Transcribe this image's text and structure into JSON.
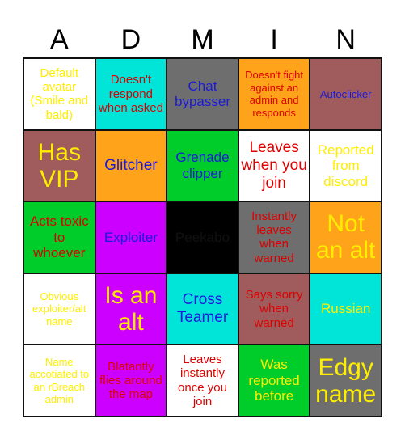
{
  "title_letters": [
    "A",
    "D",
    "M",
    "I",
    "N"
  ],
  "colors": {
    "white": "#ffffff",
    "cyan": "#00e5d8",
    "gray": "#6e6e6e",
    "orange": "#ffa31a",
    "mauve": "#a05c5c",
    "green": "#00cc2a",
    "purple": "#cc00ff",
    "black": "#000000",
    "text_yellow": "#ffee00",
    "text_red": "#dd0000",
    "text_blue": "#1a1adb",
    "text_black": "#111111",
    "grid_line": "#111111"
  },
  "cells": [
    {
      "text": "Default avatar (Smile and bald)",
      "bg": "#ffffff",
      "fg": "#ffee00",
      "size": "fs-s"
    },
    {
      "text": "Doesn't respond when asked",
      "bg": "#00e5d8",
      "fg": "#dd0000",
      "size": "fs-s"
    },
    {
      "text": "Chat bypasser",
      "bg": "#6e6e6e",
      "fg": "#1a1adb",
      "size": "fs-m"
    },
    {
      "text": "Doesn't fight against an admin and responds",
      "bg": "#ffa31a",
      "fg": "#dd0000",
      "size": "fs-xs"
    },
    {
      "text": "Autoclicker",
      "bg": "#a05c5c",
      "fg": "#1a1adb",
      "size": "fs-xs"
    },
    {
      "text": "Has VIP",
      "bg": "#a05c5c",
      "fg": "#ffee00",
      "size": "fs-xl"
    },
    {
      "text": "Glitcher",
      "bg": "#ffa31a",
      "fg": "#1a1adb",
      "size": "fs-l"
    },
    {
      "text": "Grenade clipper",
      "bg": "#00cc2a",
      "fg": "#1a1adb",
      "size": "fs-m"
    },
    {
      "text": "Leaves when you join",
      "bg": "#ffffff",
      "fg": "#dd0000",
      "size": "fs-l"
    },
    {
      "text": "Reported from discord",
      "bg": "#ffffff",
      "fg": "#ffee00",
      "size": "fs-m"
    },
    {
      "text": "Acts toxic to whoever",
      "bg": "#00cc2a",
      "fg": "#dd0000",
      "size": "fs-m"
    },
    {
      "text": "Exploiter",
      "bg": "#cc00ff",
      "fg": "#1a1adb",
      "size": "fs-m"
    },
    {
      "text": "Peekabo",
      "bg": "#000000",
      "fg": "#111111",
      "size": "fs-m"
    },
    {
      "text": "Instantly leaves when warned",
      "bg": "#6e6e6e",
      "fg": "#dd0000",
      "size": "fs-s"
    },
    {
      "text": "Not an alt",
      "bg": "#ffa31a",
      "fg": "#ffee00",
      "size": "fs-xl"
    },
    {
      "text": "Obvious exploiter/alt name",
      "bg": "#ffffff",
      "fg": "#ffee00",
      "size": "fs-xs"
    },
    {
      "text": "Is an alt",
      "bg": "#cc00ff",
      "fg": "#ffee00",
      "size": "fs-xl"
    },
    {
      "text": "Cross Teamer",
      "bg": "#00e5d8",
      "fg": "#1a1adb",
      "size": "fs-l"
    },
    {
      "text": "Says sorry when warned",
      "bg": "#a05c5c",
      "fg": "#dd0000",
      "size": "fs-s"
    },
    {
      "text": "Russian",
      "bg": "#00e5d8",
      "fg": "#ffee00",
      "size": "fs-m"
    },
    {
      "text": "Name accotiated to an rBreach admin",
      "bg": "#ffffff",
      "fg": "#ffee00",
      "size": "fs-xs"
    },
    {
      "text": "Blatantly flies around the map",
      "bg": "#cc00ff",
      "fg": "#dd0000",
      "size": "fs-s"
    },
    {
      "text": "Leaves instantly once you join",
      "bg": "#ffffff",
      "fg": "#dd0000",
      "size": "fs-s"
    },
    {
      "text": "Was reported before",
      "bg": "#00cc2a",
      "fg": "#ffee00",
      "size": "fs-m"
    },
    {
      "text": "Edgy name",
      "bg": "#6e6e6e",
      "fg": "#ffee00",
      "size": "fs-xl"
    }
  ]
}
